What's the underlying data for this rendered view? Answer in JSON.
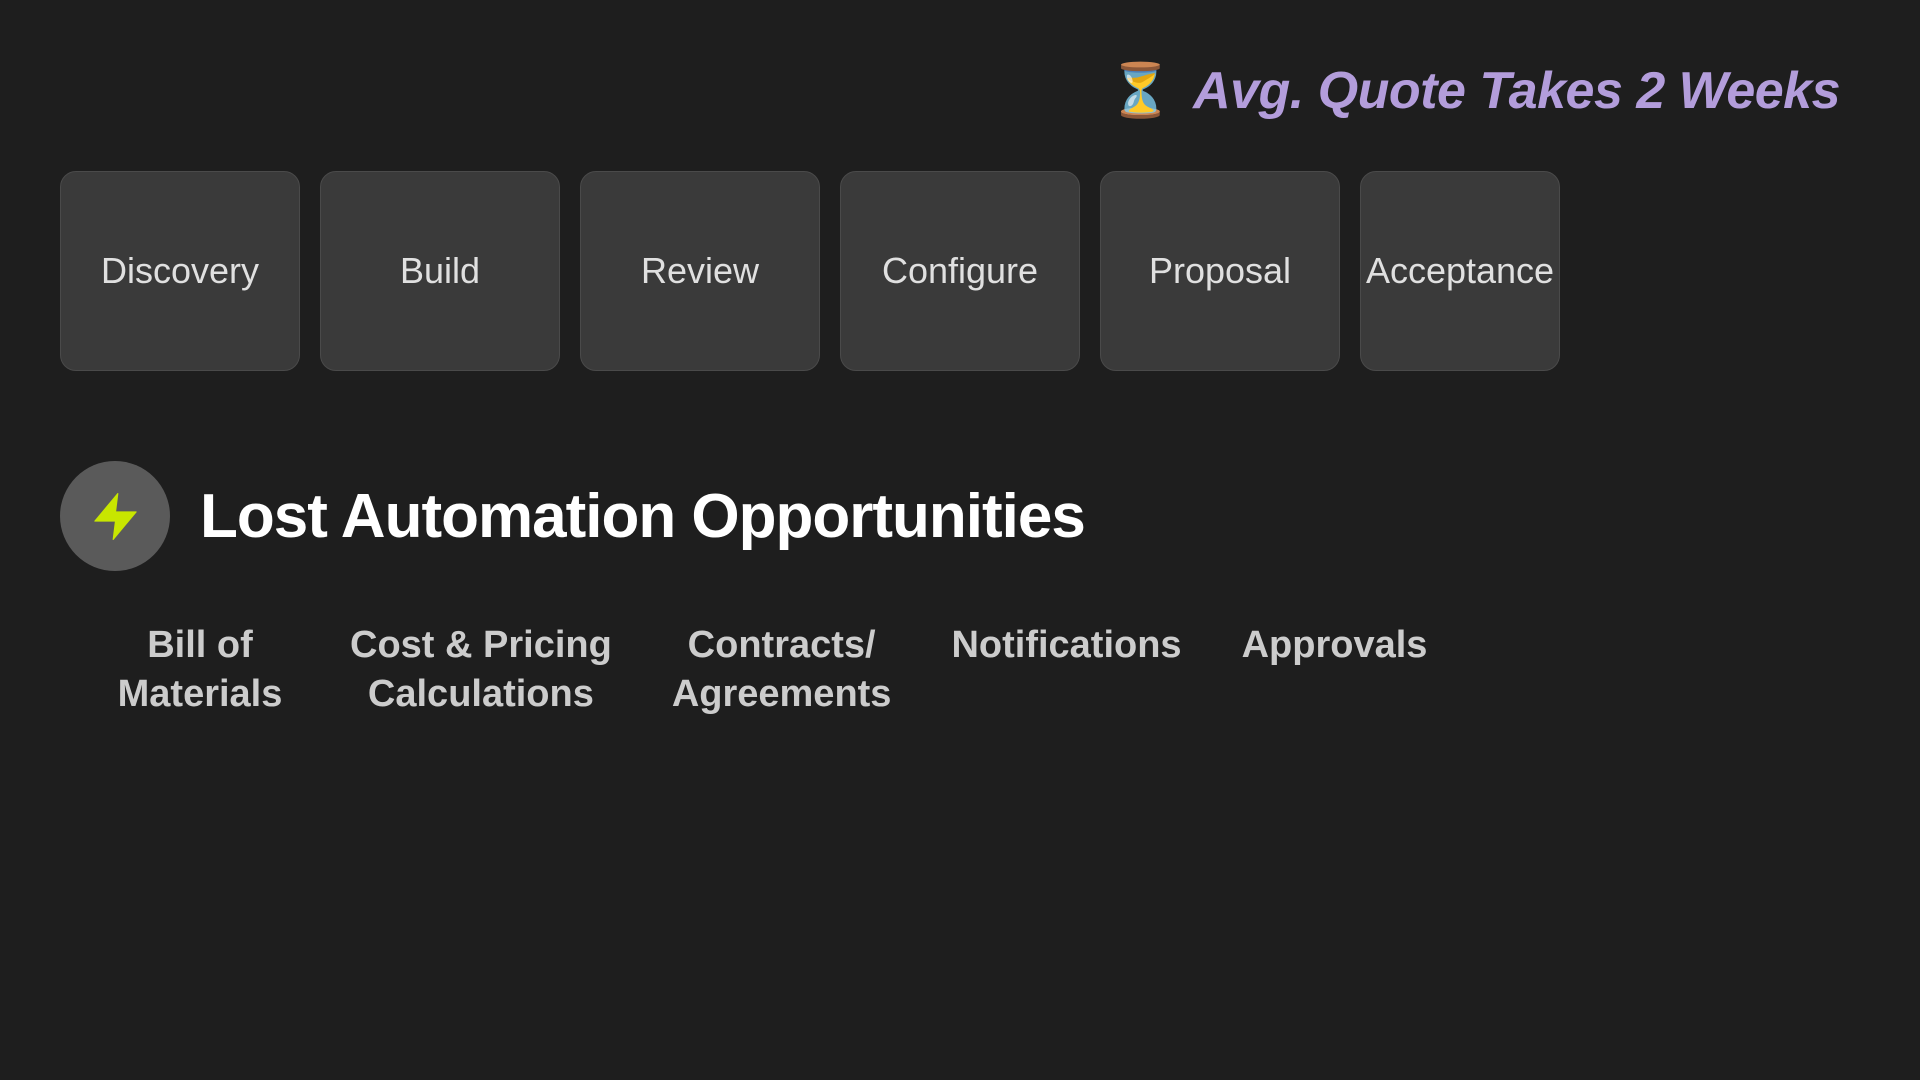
{
  "header": {
    "avg_quote_label": "Avg. Quote Takes 2 Weeks",
    "hourglass_icon": "⏳"
  },
  "process_steps": [
    {
      "id": "discovery",
      "label": "Discovery"
    },
    {
      "id": "build",
      "label": "Build"
    },
    {
      "id": "review",
      "label": "Review"
    },
    {
      "id": "configure",
      "label": "Configure"
    },
    {
      "id": "proposal",
      "label": "Proposal"
    },
    {
      "id": "acceptance",
      "label": "Acceptance"
    }
  ],
  "lost_automation": {
    "section_title": "Lost Automation Opportunities",
    "items": [
      {
        "id": "bill-of-materials",
        "label": "Bill of\nMaterials"
      },
      {
        "id": "cost-pricing",
        "label": "Cost & Pricing\nCalculations"
      },
      {
        "id": "contracts-agreements",
        "label": "Contracts/\nAgreements"
      },
      {
        "id": "notifications",
        "label": "Notifications"
      },
      {
        "id": "approvals",
        "label": "Approvals"
      }
    ]
  }
}
